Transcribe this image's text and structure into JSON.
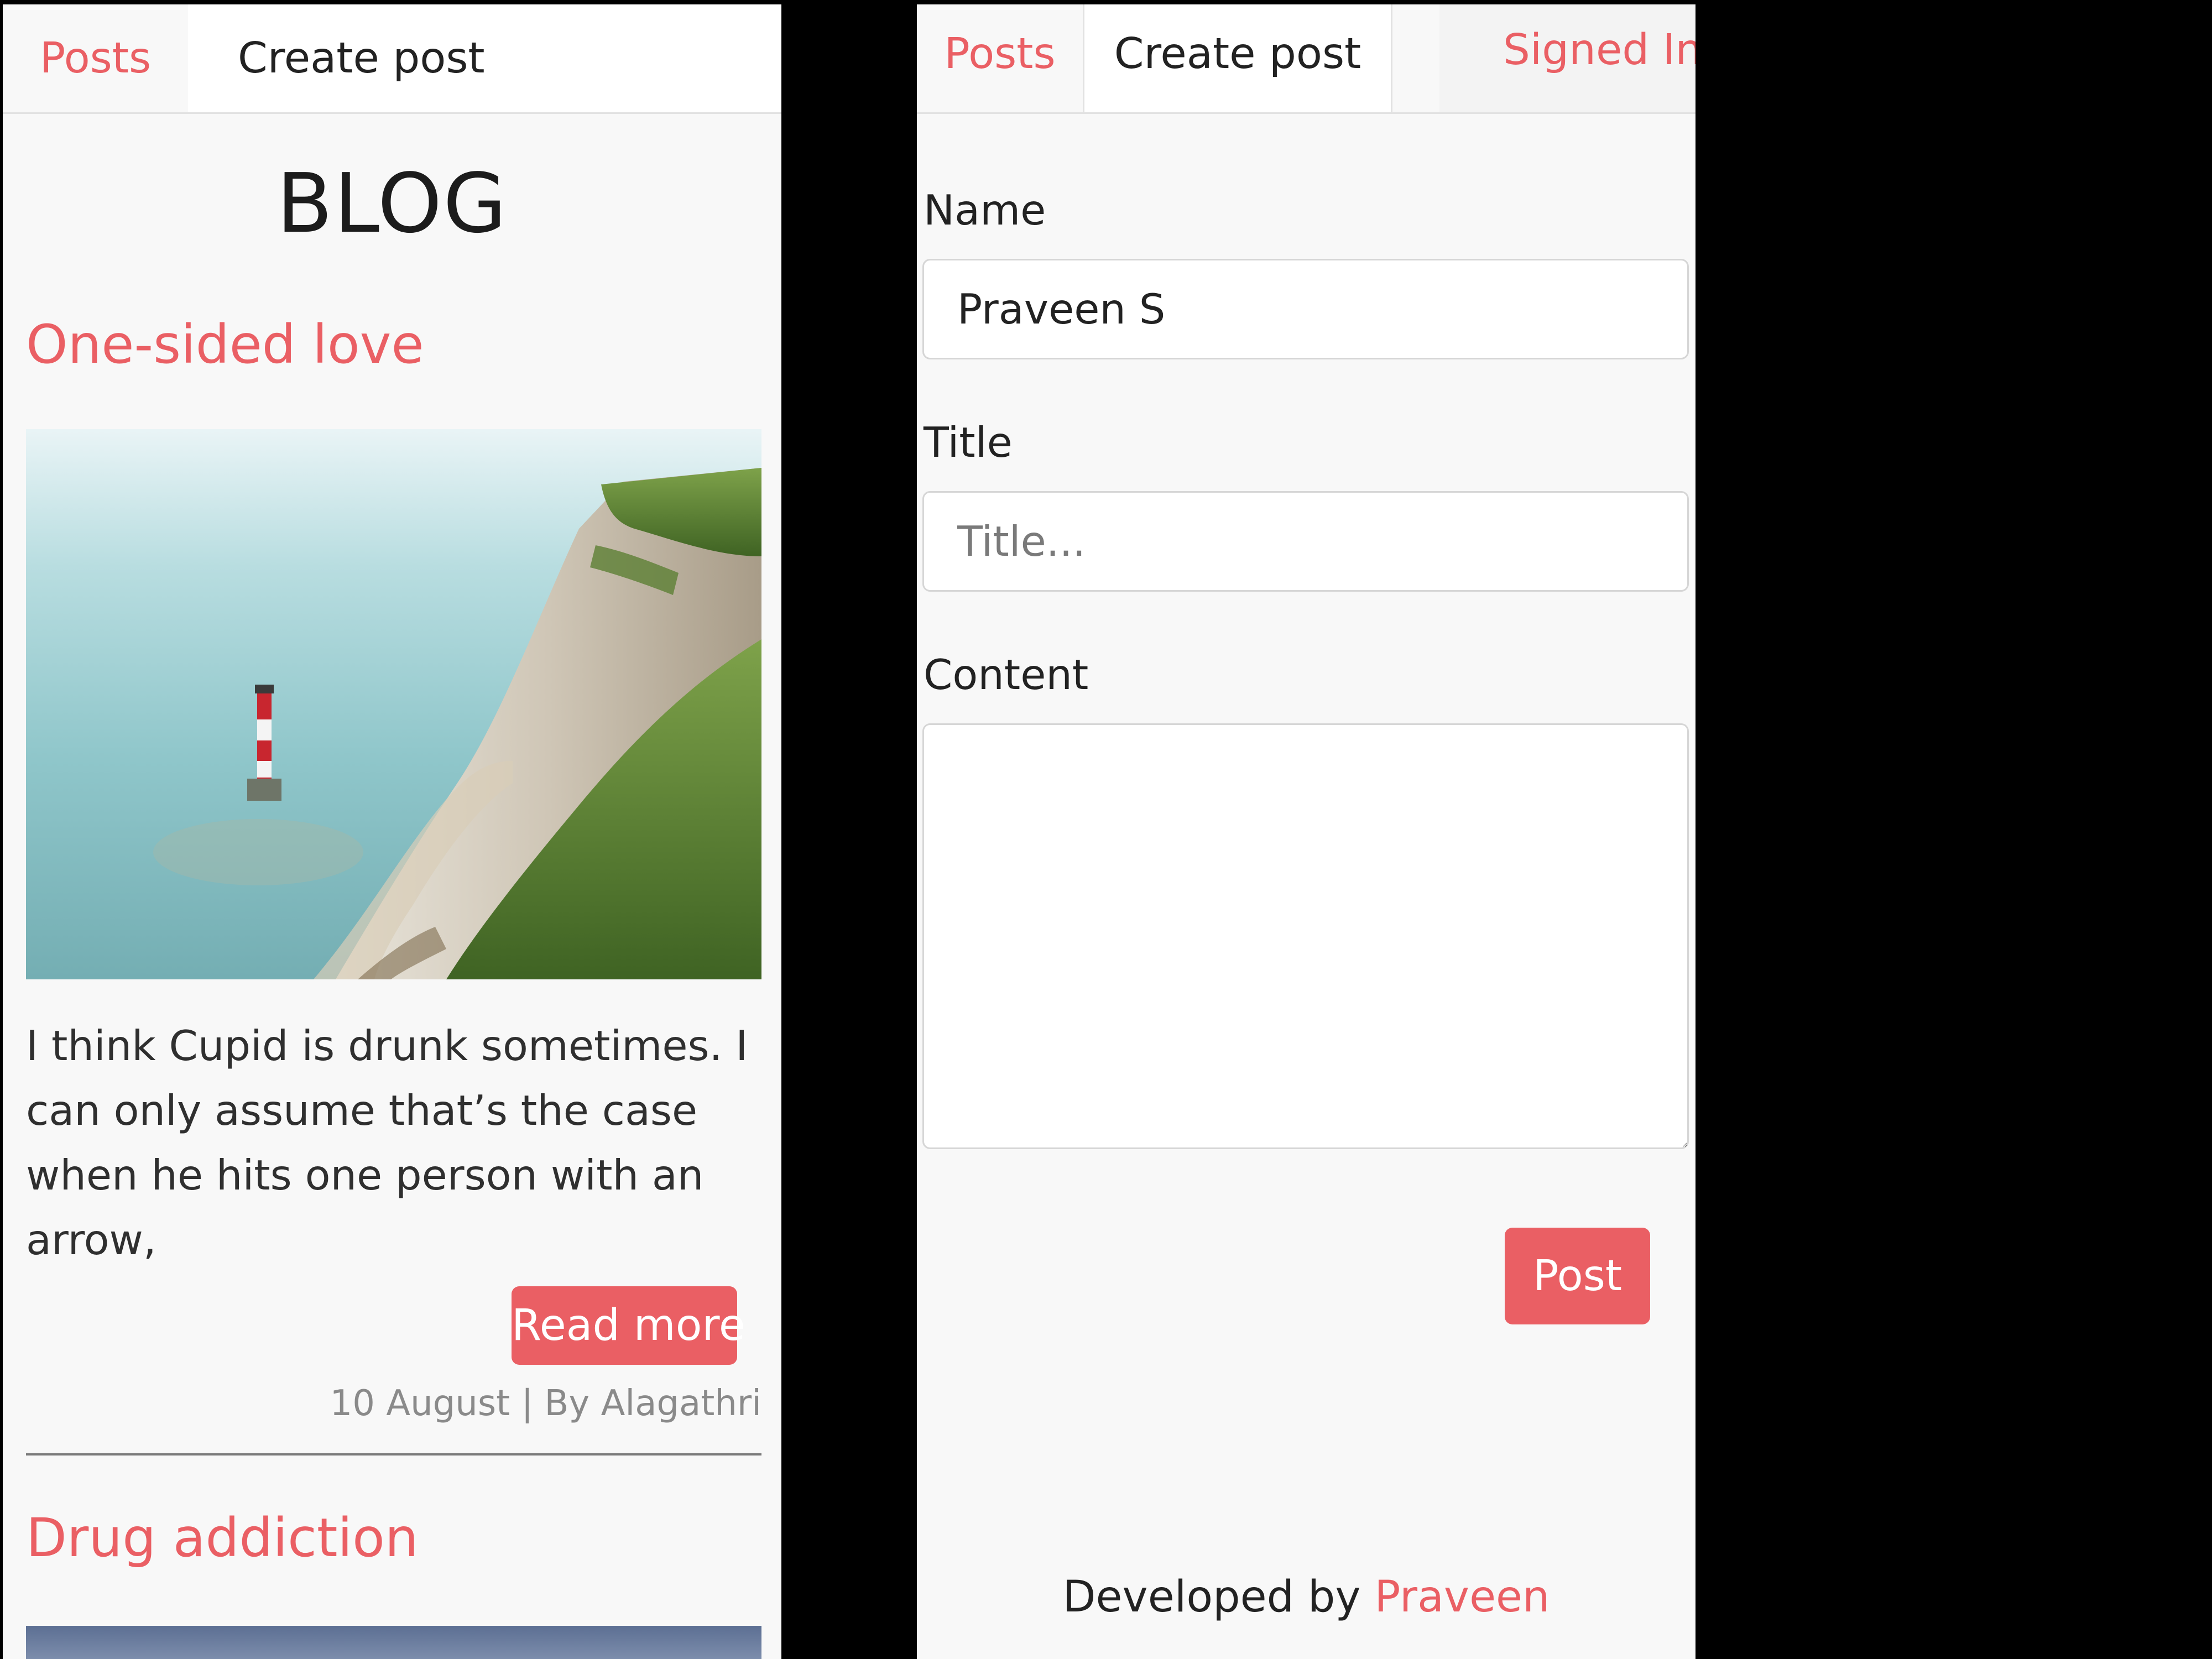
{
  "left_panel": {
    "nav": {
      "posts_label": "Posts",
      "create_label": "Create post"
    },
    "heading": "BLOG",
    "posts": [
      {
        "title": "One-sided love",
        "excerpt": "I think Cupid is drunk sometimes. I can only assume that’s the case when he hits one person with an arrow,",
        "read_more_label": "Read more",
        "date": "10 August",
        "separator": "|",
        "author": "By Alagathri"
      },
      {
        "title": "Drug addiction"
      }
    ]
  },
  "right_panel": {
    "nav": {
      "posts_label": "Posts",
      "create_label": "Create post",
      "signed_in_label": "Signed In"
    },
    "form": {
      "name_label": "Name",
      "name_value": "Praveen S",
      "title_label": "Title",
      "title_placeholder": "Title...",
      "content_label": "Content",
      "content_value": "",
      "submit_label": "Post"
    },
    "footer": {
      "prefix": "Developed by",
      "author_link": "Praveen"
    }
  },
  "colors": {
    "accent": "#ea5f64",
    "page_background": "#f8f8f8",
    "backdrop": "#000000"
  },
  "icons": {
    "post_1_image": "lighthouse-cliff-photo",
    "post_2_image": "partial-photo",
    "textarea_resize": "resize-handle-icon"
  }
}
